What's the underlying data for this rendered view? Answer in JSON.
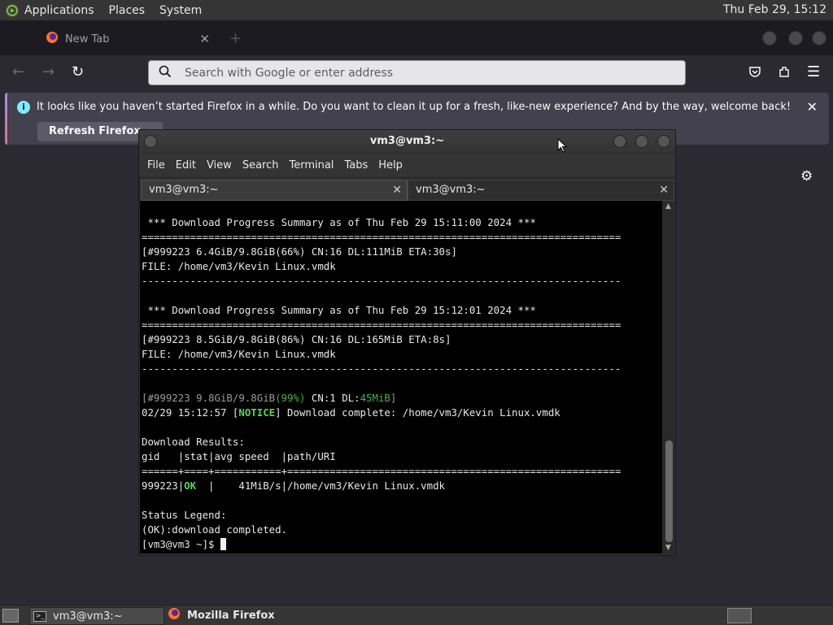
{
  "top_panel": {
    "menus": [
      "Applications",
      "Places",
      "System"
    ],
    "clock": "Thu Feb 29, 15:12"
  },
  "firefox": {
    "tab_title": "New Tab",
    "urlbar_placeholder": "Search with Google or enter address",
    "notification": {
      "message": "It looks like you haven’t started Firefox in a while. Do you want to clean it up for a fresh, like-new experience? And by the way, welcome back!",
      "button": "Refresh Firefox…"
    }
  },
  "terminal": {
    "title": "vm3@vm3:~",
    "menu": [
      "File",
      "Edit",
      "View",
      "Search",
      "Terminal",
      "Tabs",
      "Help"
    ],
    "tabs": [
      "vm3@vm3:~",
      "vm3@vm3:~"
    ],
    "lines": {
      "l1": " *** Download Progress Summary as of Thu Feb 29 15:11:00 2024 ***",
      "l2": "===============================================================================",
      "l3": "[#999223 6.4GiB/9.8GiB(66%) CN:16 DL:111MiB ETA:30s]",
      "l4": "FILE: /home/vm3/Kevin Linux.vmdk",
      "l5": "-------------------------------------------------------------------------------",
      "l6": " *** Download Progress Summary as of Thu Feb 29 15:12:01 2024 ***",
      "l7": "===============================================================================",
      "l8": "[#999223 8.5GiB/9.8GiB(86%) CN:16 DL:165MiB ETA:8s]",
      "l9": "FILE: /home/vm3/Kevin Linux.vmdk",
      "l10": "-------------------------------------------------------------------------------",
      "l11a": "[#999223 9.8GiB/9.8GiB",
      "l11b": "(99%)",
      "l11c": " CN:1 DL:",
      "l11d": "45MiB",
      "l11e": "]",
      "l12a": "02/29 15:12:57 [",
      "l12b": "NOTICE",
      "l12c": "] Download complete: /home/vm3/Kevin Linux.vmdk",
      "l13": "Download Results:",
      "l14": "gid   |stat|avg speed  |path/URI",
      "l15": "======+====+===========+=======================================================",
      "l16a": "999223|",
      "l16b": "OK",
      "l16c": "  |    41MiB/s|/home/vm3/Kevin Linux.vmdk",
      "l17": "Status Legend:",
      "l18": "(OK):download completed.",
      "l19": "[vm3@vm3 ~]$ "
    }
  },
  "taskbar": {
    "items": [
      "vm3@vm3:~",
      "Mozilla Firefox"
    ]
  }
}
